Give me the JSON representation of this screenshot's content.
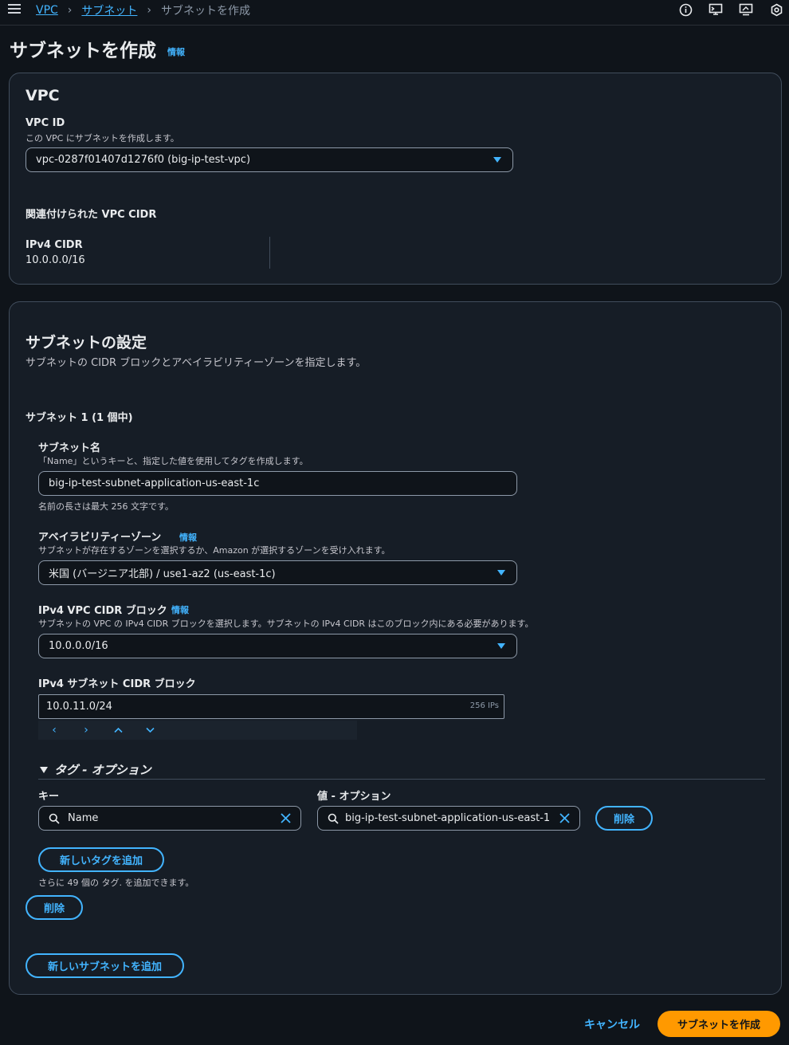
{
  "breadcrumbs": {
    "vpc": "VPC",
    "subnets": "サブネット",
    "current": "サブネットを作成"
  },
  "top_icons": [
    "info-icon",
    "cloudshell-icon",
    "feedback-icon",
    "settings-icon"
  ],
  "page": {
    "title": "サブネットを作成",
    "info": "情報"
  },
  "vpc_section": {
    "heading": "VPC",
    "vpc_id_label": "VPC ID",
    "vpc_id_desc": "この VPC にサブネットを作成します。",
    "vpc_id_value": "vpc-0287f01407d1276f0 (big-ip-test-vpc)",
    "cidr_heading": "関連付けられた VPC CIDR",
    "ipv4_label": "IPv4 CIDR",
    "ipv4_value": "10.0.0.0/16"
  },
  "subnet_settings": {
    "heading": "サブネットの設定",
    "desc": "サブネットの CIDR ブロックとアベイラビリティーゾーンを指定します。",
    "subnet_count": "サブネット 1 (1 個中)",
    "name_label": "サブネット名",
    "name_desc": "「Name」というキーと、指定した値を使用してタグを作成します。",
    "name_value": "big-ip-test-subnet-application-us-east-1c",
    "name_hint": "名前の長さは最大 256 文字です。",
    "az_label": "アベイラビリティーゾーン",
    "az_info": "情報",
    "az_desc": "サブネットが存在するゾーンを選択するか、Amazon が選択するゾーンを受け入れます。",
    "az_value": "米国 (バージニア北部) / use1-az2 (us-east-1c)",
    "vpc_cidr_label": "IPv4 VPC CIDR ブロック",
    "vpc_cidr_info": "情報",
    "vpc_cidr_desc": "サブネットの VPC の IPv4 CIDR ブロックを選択します。サブネットの IPv4 CIDR はこのブロック内にある必要があります。",
    "vpc_cidr_value": "10.0.0.0/16",
    "subnet_cidr_label": "IPv4 サブネット CIDR ブロック",
    "subnet_cidr_value": "10.0.11.0/24",
    "subnet_cidr_count": "256 IPs",
    "tags_heading": "タグ - オプション",
    "key_label": "キー",
    "value_label": "値 - オプション",
    "key_value": "Name",
    "value_value": "big-ip-test-subnet-application-us-east-1",
    "tag_remove": "削除",
    "add_tag": "新しいタグを追加",
    "tag_hint": "さらに 49 個の タグ. を追加できます。",
    "subnet_remove": "削除",
    "add_subnet": "新しいサブネットを追加"
  },
  "footer": {
    "cancel": "キャンセル",
    "create": "サブネットを作成"
  },
  "colors": {
    "accent": "#42b4ff",
    "primary_button": "#ff9900",
    "background": "#0f141a"
  }
}
